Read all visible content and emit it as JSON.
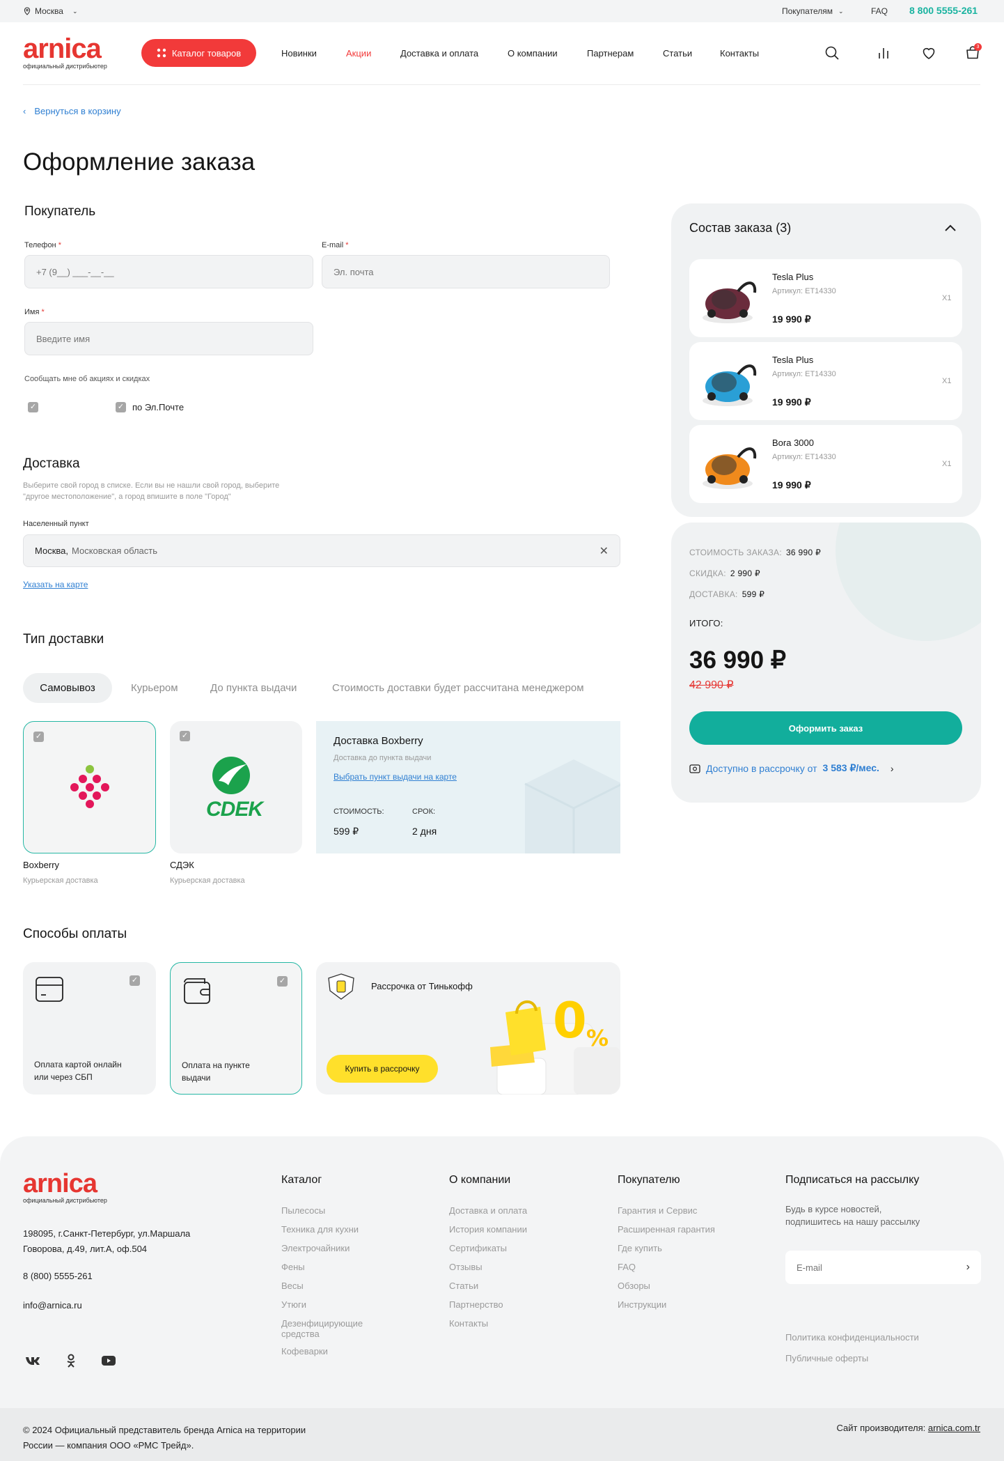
{
  "topbar": {
    "city": "Москва",
    "buyers": "Покупателям",
    "faq": "FAQ",
    "phone": "8 800 5555-261"
  },
  "header": {
    "logo": "arnica",
    "logo_sub": "официальный дистрибьютер",
    "catalog_button": "Каталог товаров",
    "nav": [
      "Новинки",
      "Акции",
      "Доставка и оплата",
      "О компании",
      "Партнерам",
      "Статьи",
      "Контакты"
    ],
    "cart_count": "3"
  },
  "back_link": "Вернуться в корзину",
  "page_title": "Оформление заказа",
  "buyer": {
    "heading": "Покупатель",
    "phone_label": "Телефон",
    "phone_placeholder": "+7 (9__) ___-__-__",
    "email_label": "E-mail",
    "email_placeholder": "Эл. почта",
    "name_label": "Имя",
    "name_placeholder": "Введите имя",
    "notify_label": "Сообщать мне об акциях и скидках",
    "notify_email": "по Эл.Почте",
    "required_mark": "*"
  },
  "delivery": {
    "heading": "Доставка",
    "hint_line1": "Выберите свой город в списке. Если вы не нашли свой город, выберите",
    "hint_line2": "\"другое местоположение\", а город впишите в поле \"Город\"",
    "city_label": "Населенный пункт",
    "city_value": "Москва,",
    "city_region": "Московская область",
    "map_link": "Указать на карте"
  },
  "delivery_type": {
    "heading": "Тип доставки",
    "tabs": [
      "Самовывоз",
      "Курьером",
      "До пункта выдачи",
      "Стоимость доставки будет рассчитана менеджером"
    ],
    "active_tab": "Самовывоз",
    "cards": [
      {
        "name": "Boxberry",
        "sub": "Курьерская доставка",
        "selected": true
      },
      {
        "name": "СДЭК",
        "sub": "Курьерская доставка",
        "selected": false
      }
    ],
    "cdek_logo": "CDEK",
    "info": {
      "title": "Доставка Boxberry",
      "sub": "Доставка до пункта выдачи",
      "link": "Выбрать пункт выдачи на карте",
      "cost_label": "СТОИМОСТЬ:",
      "cost_value": "599 ₽",
      "term_label": "СРОК:",
      "term_value": "2 дня"
    }
  },
  "payment": {
    "heading": "Способы оплаты",
    "methods": [
      {
        "line1": "Оплата картой онлайн",
        "line2": "или через СБП",
        "selected": false
      },
      {
        "line1": "Оплата на пункте",
        "line2": "выдачи",
        "selected": true
      }
    ],
    "promo_title": "Рассрочка от Тинькофф",
    "promo_button": "Купить в рассрочку"
  },
  "order": {
    "heading": "Состав заказа (3)",
    "items": [
      {
        "name": "Tesla Plus",
        "article": "Артикул: ET14330",
        "price": "19 990 ₽",
        "qty": "X1",
        "color": "#6a2c3c"
      },
      {
        "name": "Tesla Plus",
        "article": "Артикул: ET14330",
        "price": "19 990 ₽",
        "qty": "X1",
        "color": "#2a9fd6"
      },
      {
        "name": "Bora 3000",
        "article": "Артикул: ET14330",
        "price": "19 990 ₽",
        "qty": "X1",
        "color": "#f08a1c"
      }
    ]
  },
  "summary": {
    "cost_label": "СТОИМОСТЬ ЗАКАЗА:",
    "cost_value": "36 990 ₽",
    "discount_label": "СКИДКА:",
    "discount_value": "2 990 ₽",
    "delivery_label": "ДОСТАВКА:",
    "delivery_value": "599 ₽",
    "total_label": "ИТОГО:",
    "total_value": "36 990 ₽",
    "old_price": "42 990 ₽",
    "order_button": "Оформить заказ",
    "installment_text": "Доступно в рассрочку от",
    "installment_value": "3 583 ₽/мес."
  },
  "footer": {
    "address_line1": "198095, г.Санкт-Петербург, ул.Маршала",
    "address_line2": "Говорова, д.49, лит.А, оф.504",
    "phone": "8 (800) 5555-261",
    "email": "info@arnica.ru",
    "catalog_heading": "Каталог",
    "catalog_links": [
      "Пылесосы",
      "Техника для кухни",
      "Электрочайники",
      "Фены",
      "Весы",
      "Утюги",
      "Дезенфицирующие средства",
      "Кофеварки"
    ],
    "company_heading": "О компании",
    "company_links": [
      "Доставка и оплата",
      "История компании",
      "Сертификаты",
      "Отзывы",
      "Статьи",
      "Партнерство",
      "Контакты"
    ],
    "buyer_heading": "Покупателю",
    "buyer_links": [
      "Гарантия и Сервис",
      "Расширенная гарантия",
      "Где купить",
      "FAQ",
      "Обзоры",
      "Инструкции"
    ],
    "subscribe_heading": "Подписаться на рассылку",
    "subscribe_text_line1": "Будь в курсе новостей,",
    "subscribe_text_line2": "подпишитесь на нашу рассылку",
    "subscribe_placeholder": "E-mail",
    "privacy": "Политика конфиденциальности",
    "offer": "Публичные оферты",
    "copyright_line1": "© 2024 Официальный представитель бренда Arnica на территории",
    "copyright_line2": "России — компания ООО «РМС Трейд».",
    "maker_label": "Сайт производителя:",
    "maker_link": "arnica.com.tr"
  },
  "colors": {
    "brand_red": "#e63631",
    "accent_teal": "#12ae9c",
    "link_blue": "#2f7fd2",
    "promo_yellow": "#ffe02b"
  }
}
